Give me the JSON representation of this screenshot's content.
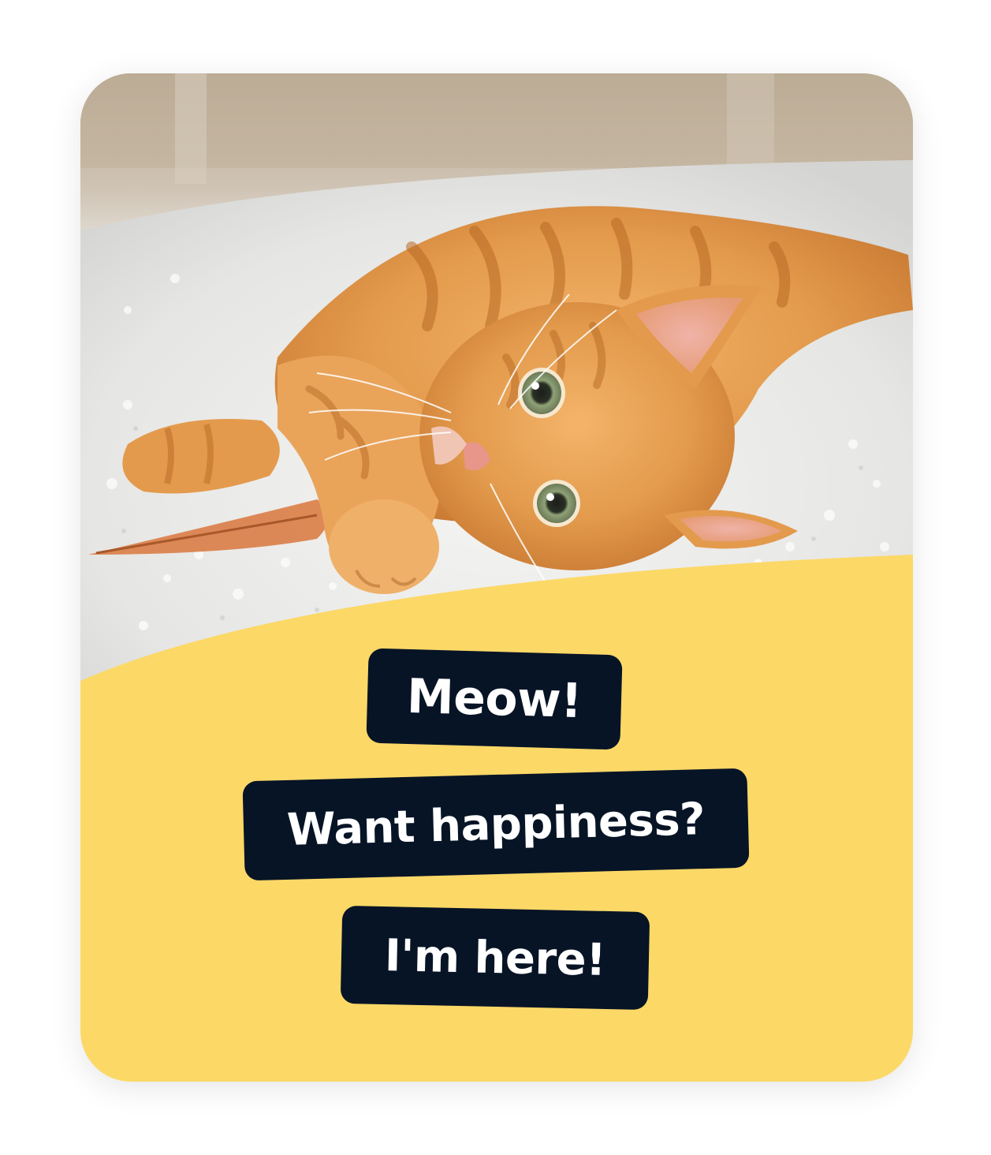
{
  "card": {
    "background_color": "#FCD867",
    "pill_color": "#071426",
    "pill_text_color": "#FFFFFF"
  },
  "photo": {
    "icon": "kitten-photo"
  },
  "messages": [
    {
      "text": "Meow!"
    },
    {
      "text": "Want happiness?"
    },
    {
      "text": "I'm here!"
    }
  ]
}
